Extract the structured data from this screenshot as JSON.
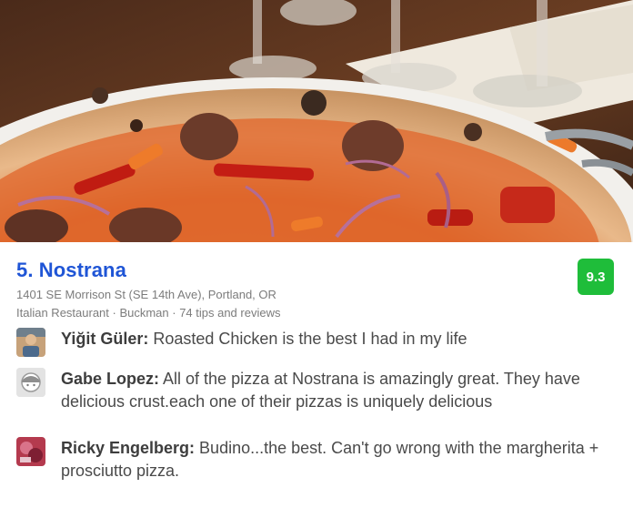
{
  "venue": {
    "rank_name": "5. Nostrana",
    "address": "1401 SE Morrison St (SE 14th Ave), Portland, OR",
    "meta": "Italian Restaurant · Buckman · 74 tips and reviews",
    "score": "9.3",
    "colors": {
      "title": "#1f55d6",
      "score_bg": "#1fbd3a",
      "secondary_text": "#7c7c7c"
    }
  },
  "tips": [
    {
      "author": "Yiğit Güler:",
      "text": " Roasted Chicken is the best I had in my life",
      "avatar": "user-photo"
    },
    {
      "author": "Gabe Lopez:",
      "text": " All of the pizza at Nostrana is amazingly great. They have delicious crust.each one of their pizzas is uniquely delicious",
      "avatar": "default-avatar-icon"
    },
    {
      "author": "Ricky Engelberg:",
      "text": " Budino...the best. Can't go wrong with the margherita + prosciutto pizza.",
      "avatar": "user-photo"
    }
  ]
}
